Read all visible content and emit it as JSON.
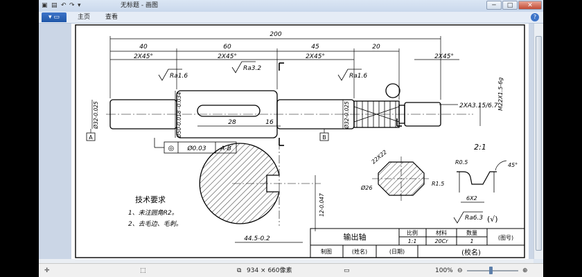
{
  "window": {
    "title": "无标题 - 画图",
    "menu_tabs": [
      "主页",
      "查看"
    ],
    "controls": [
      "─",
      "□",
      "✕"
    ]
  },
  "drawing": {
    "dims": {
      "d200": "200",
      "d40": "40",
      "d60": "60",
      "d45": "45",
      "d20": "20",
      "c1": "2X45°",
      "c2": "2X45°",
      "c3": "2X45°",
      "c4": "2X45°",
      "ra1": "Ra1.6",
      "ra2": "Ra3.2",
      "ra3": "Ra1.6",
      "thread": "M22X1.5-6g",
      "undercut": "2XA3.15/6.7",
      "dia32a": "Ø32-0.025",
      "dia50": "Ø50-0.018 -0.034",
      "dia32b": "Ø32-0.025",
      "d28": "28",
      "d16": "16",
      "datum_a": "A",
      "datum_b": "B",
      "tol_sym": "◎",
      "tol_val": "Ø0.03",
      "tol_ref": "A-B",
      "sec_22": "22X22",
      "sec_26": "Ø26",
      "scale21": "2:1",
      "r05": "R0.5",
      "r15": "R1.5",
      "ang45": "45°",
      "g6x2": "6X2",
      "key_w": "12-0.047",
      "key_d": "44.5-0.2",
      "ra_general": "Ra6.3",
      "ra_check": "(√)"
    },
    "notes": {
      "heading": "技术要求",
      "line1": "1、未注圆角R2。",
      "line2": "2、去毛边、毛刺。"
    },
    "title_block": {
      "part_name": "输出轴",
      "h_scale": "比例",
      "h_material": "材料",
      "h_qty": "数量",
      "v_scale": "1:1",
      "v_material": "20Cr",
      "v_qty": "1",
      "drawing_no": "(图号)",
      "drawn_by": "制图",
      "name": "(姓名)",
      "date": "(日期)",
      "school": "(校名)"
    }
  },
  "status": {
    "size": "934 × 660像素",
    "zoom": "100%"
  }
}
